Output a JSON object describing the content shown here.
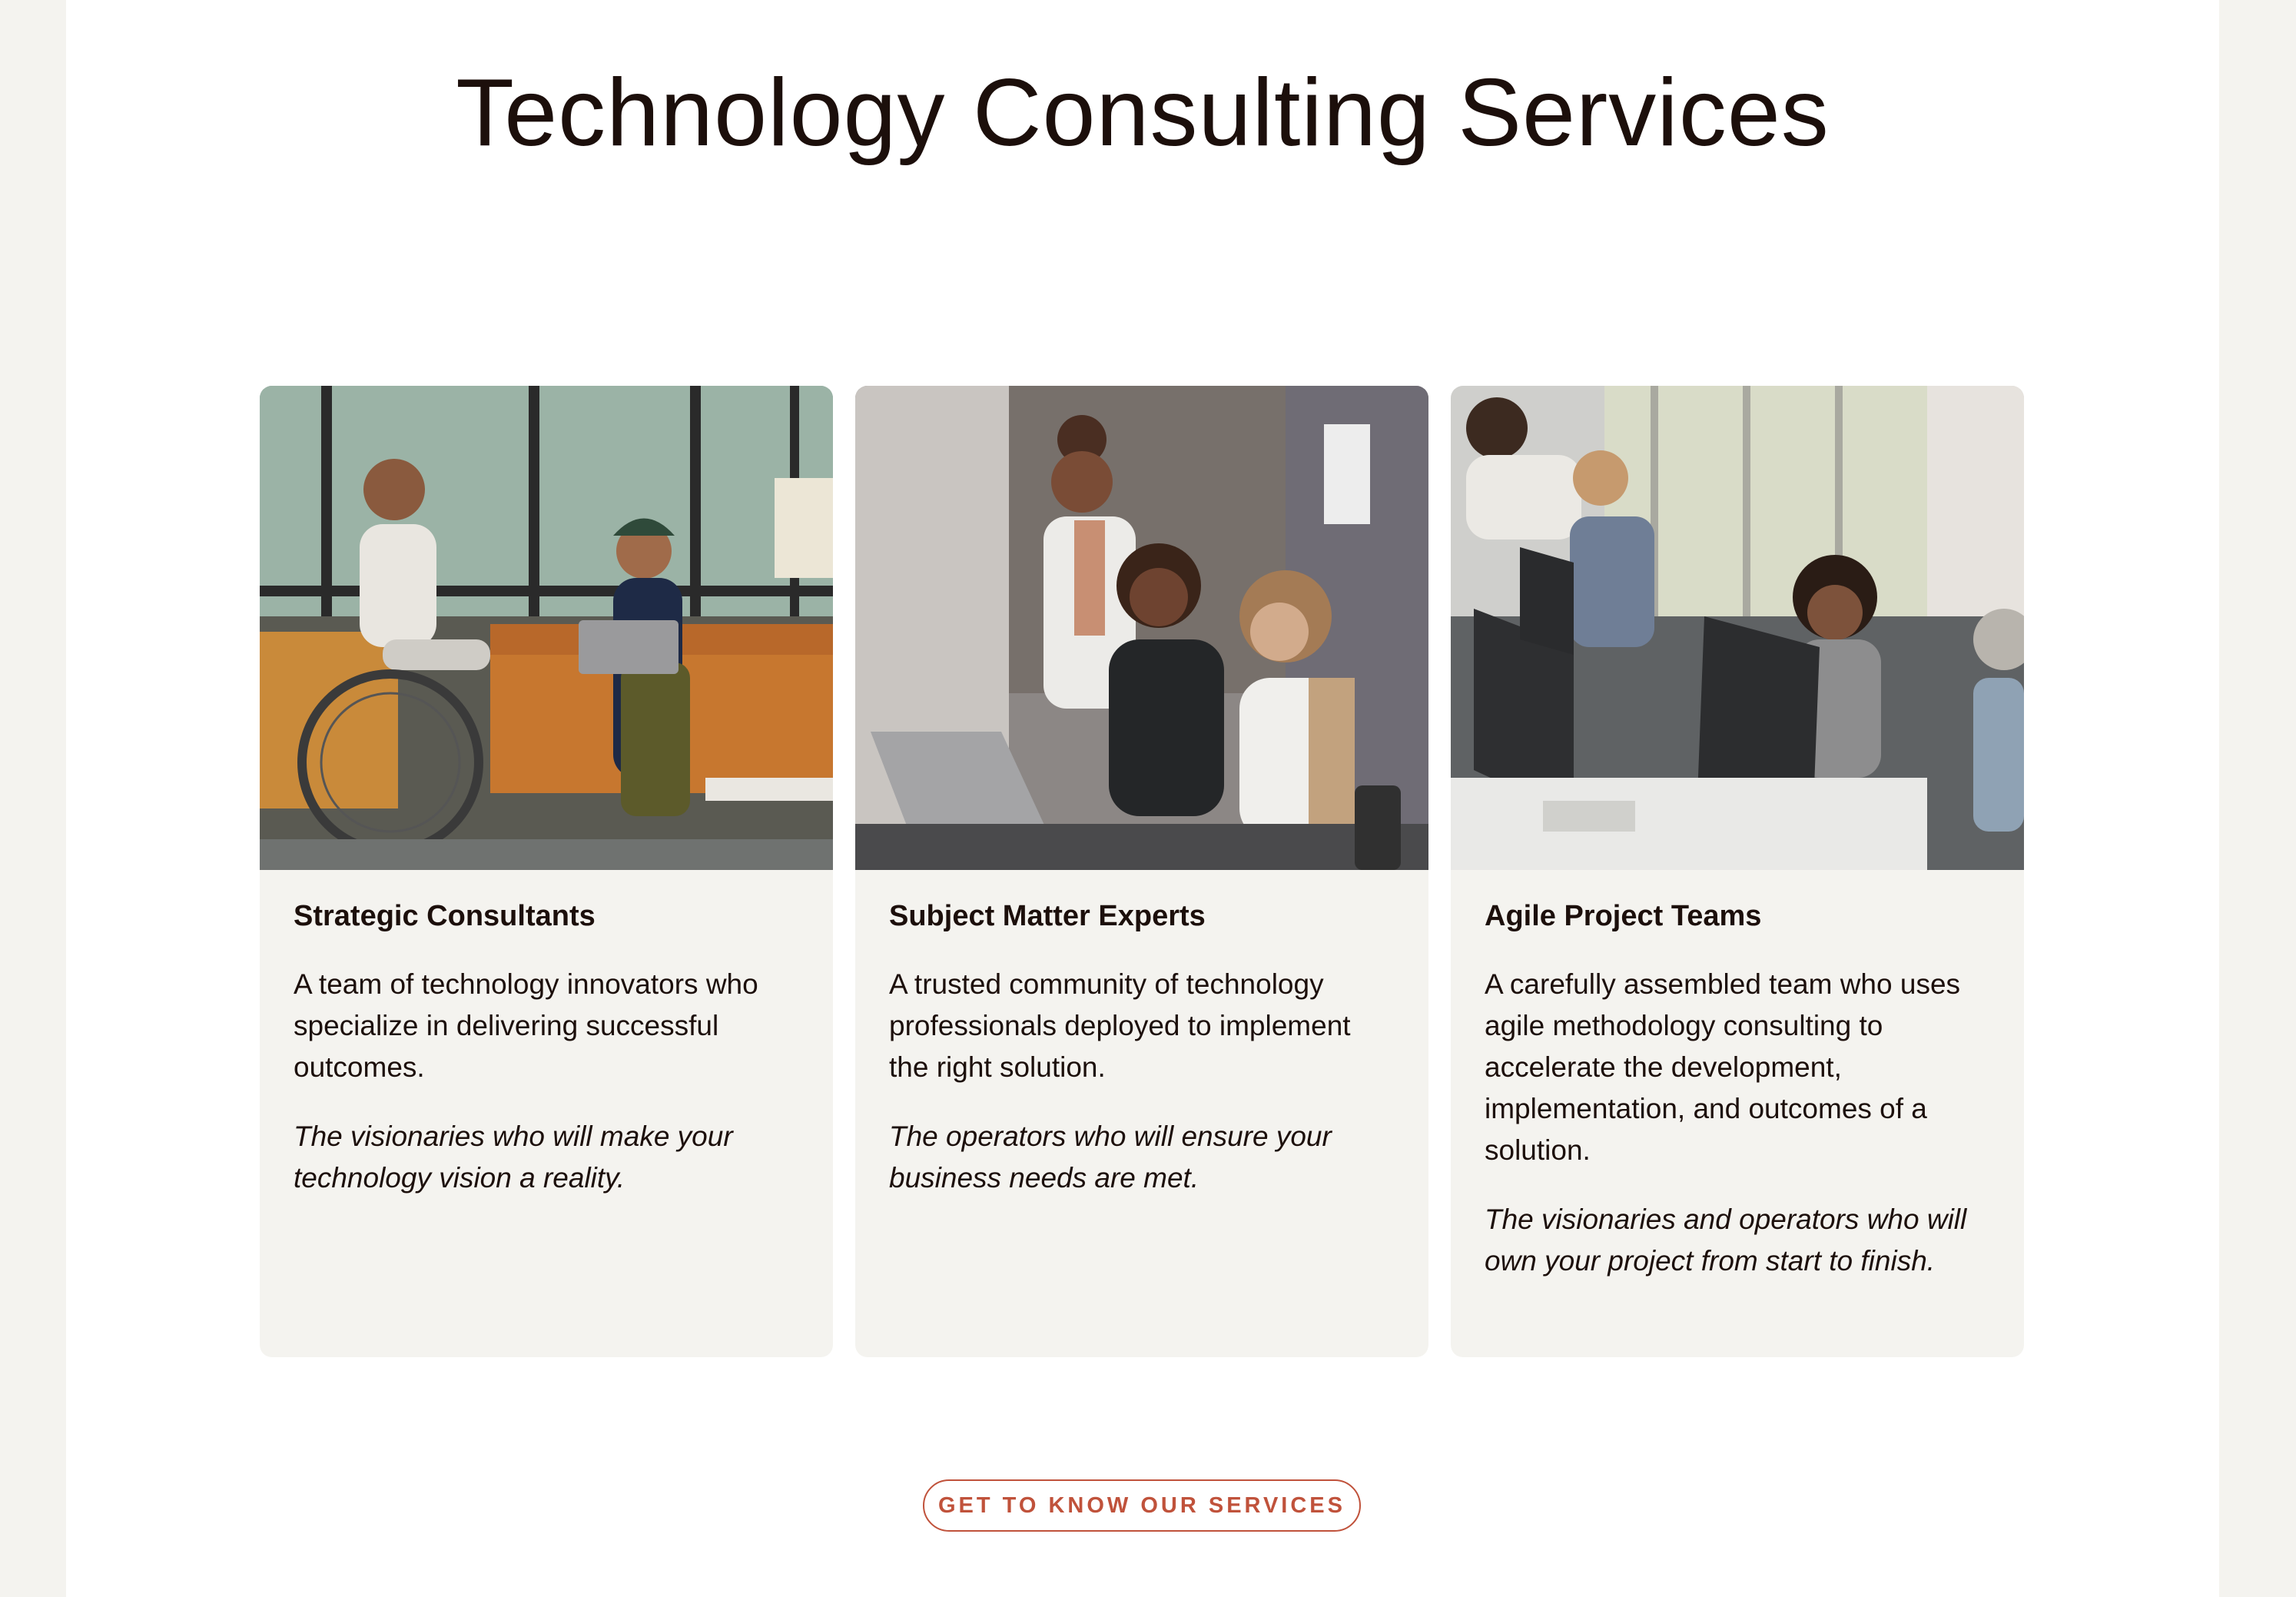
{
  "section": {
    "title": "Technology Consulting Services"
  },
  "cards": [
    {
      "title": "Strategic Consultants",
      "description": "A team of technology innovators who specialize in delivering successful outcomes.",
      "tagline": "The visionaries who will make your technology vision a reality.",
      "image_icon": "team-meeting-photo"
    },
    {
      "title": "Subject Matter Experts",
      "description": "A trusted community of technology professionals deployed to implement the right solution.",
      "tagline": "The operators who will ensure your business needs are met.",
      "image_icon": "experts-laptop-photo"
    },
    {
      "title": "Agile Project Teams",
      "description": "A carefully assembled team who uses agile methodology consulting to accelerate the development, implementation, and outcomes of a solution.",
      "tagline": "The visionaries and operators who will own your project from start to finish.",
      "image_icon": "office-workstations-photo"
    }
  ],
  "cta": {
    "label": "GET TO KNOW OUR SERVICES"
  },
  "colors": {
    "background": "#f4f3ef",
    "page": "#ffffff",
    "card": "#f4f3ef",
    "text": "#1c0f0b",
    "accent": "#c0523b"
  }
}
